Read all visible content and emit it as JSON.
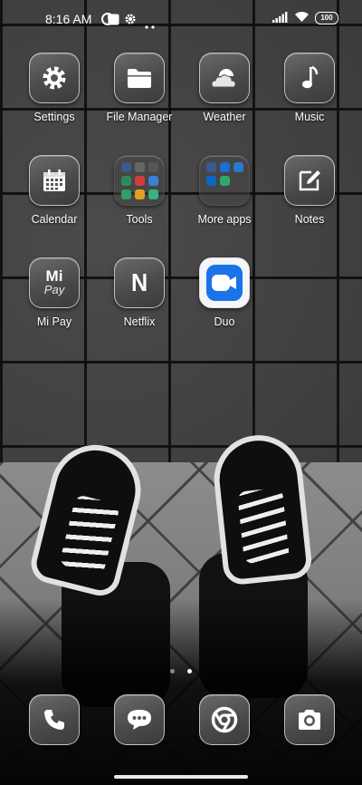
{
  "status_bar": {
    "time": "8:16 AM",
    "battery": "100"
  },
  "apps": [
    {
      "label": "Settings",
      "icon": "gear-icon"
    },
    {
      "label": "File Manager",
      "icon": "folder-icon"
    },
    {
      "label": "Weather",
      "icon": "weather-icon"
    },
    {
      "label": "Music",
      "icon": "music-note-icon"
    },
    {
      "label": "Calendar",
      "icon": "calendar-icon"
    },
    {
      "label": "Tools",
      "icon": "folder-grid-icon"
    },
    {
      "label": "More apps",
      "icon": "folder-grid-icon"
    },
    {
      "label": "Notes",
      "icon": "notes-edit-icon"
    },
    {
      "label": "Mi Pay",
      "icon": "mi-pay-logo"
    },
    {
      "label": "Netflix",
      "icon": "netflix-logo"
    },
    {
      "label": "Duo",
      "icon": "duo-video-icon"
    }
  ],
  "mi_pay_logo_text": [
    "Mi",
    "Pay"
  ],
  "netflix_logo_text": "N",
  "pages": {
    "count": 2,
    "active": 2
  },
  "dock": [
    {
      "name": "phone",
      "icon": "phone-icon"
    },
    {
      "name": "messages",
      "icon": "message-bubble-icon"
    },
    {
      "name": "browser",
      "icon": "chrome-icon"
    },
    {
      "name": "camera",
      "icon": "camera-icon"
    }
  ],
  "colors": {
    "duo_blue": "#1a73e8",
    "label_text": "#ffffff"
  }
}
